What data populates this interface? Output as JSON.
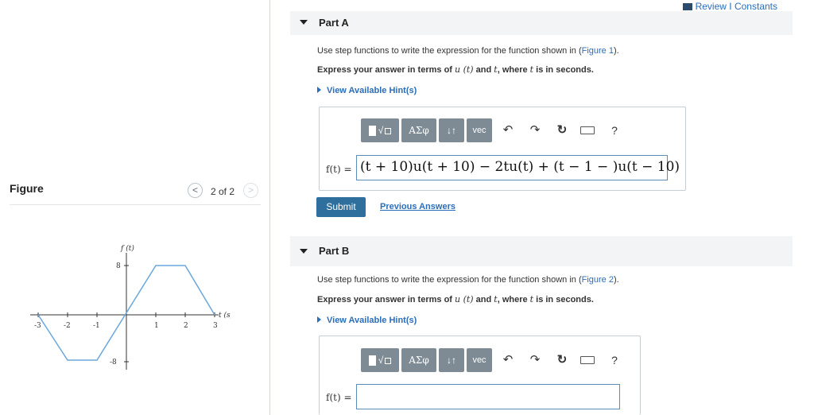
{
  "header": {
    "review_label": "Review",
    "separator": "I",
    "constants_label": "Constants"
  },
  "figure": {
    "title": "Figure",
    "prev_glyph": "<",
    "next_glyph": ">",
    "counter": "2 of 2",
    "graph": {
      "y_axis_label": "f (t)",
      "x_axis_label": "t (s)",
      "x_ticks": [
        "-3",
        "-2",
        "-1",
        "1",
        "2",
        "3"
      ],
      "y_tick_top": "8",
      "y_tick_bottom": "-8"
    }
  },
  "partA": {
    "title": "Part A",
    "instr1_text": "Use step functions to write the expression for the function shown in (",
    "instr1_link": "Figure 1",
    "instr1_end": ").",
    "instr2_a": "Express your answer in terms of ",
    "instr2_u": "u (t)",
    "instr2_b": " and ",
    "instr2_t": "t",
    "instr2_c": ", where ",
    "instr2_t2": "t",
    "instr2_d": " is in seconds.",
    "hint_label": "View Available Hint(s)",
    "eq_label": "f(t) =",
    "eq_value": "(t + 10)u(t + 10) − 2tu(t) + (t − 1 − )u(t − 10)",
    "submit_label": "Submit",
    "previous_answers_label": "Previous Answers"
  },
  "partB": {
    "title": "Part B",
    "instr1_text": "Use step functions to write the expression for the function shown in (",
    "instr1_link": "Figure 2",
    "instr1_end": ").",
    "instr2_a": "Express your answer in terms of ",
    "instr2_u": "u (t)",
    "instr2_b": " and ",
    "instr2_t": "t",
    "instr2_c": ", where ",
    "instr2_t2": "t",
    "instr2_d": " is in seconds.",
    "hint_label": "View Available Hint(s)",
    "eq_label": "f(t) ="
  },
  "toolbar": {
    "symbols_label": "ΑΣφ",
    "arrows_label": "↓↑",
    "vec_label": "vec",
    "undo_glyph": "↶",
    "redo_glyph": "↷",
    "reset_glyph": "↻",
    "help_glyph": "?"
  }
}
